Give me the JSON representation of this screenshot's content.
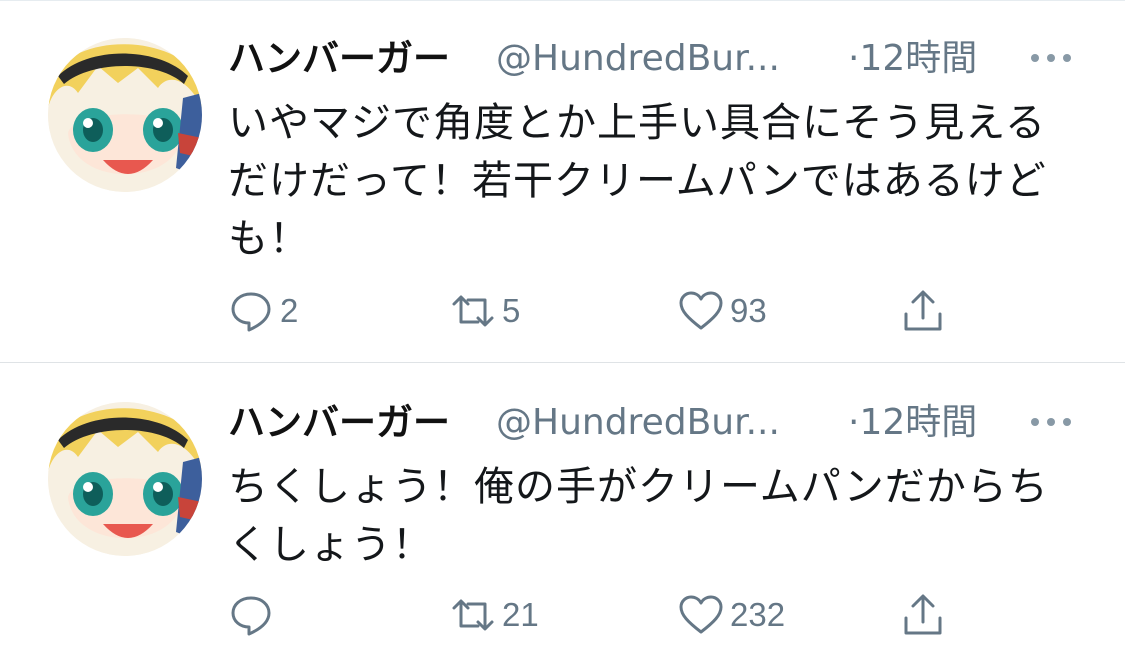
{
  "tweets": [
    {
      "name": "ハンバーガー",
      "handle": "@HundredBur...",
      "time": "·12時間",
      "lines": [
        "いやマジで角度とか上手い具合にそう見える",
        "だけだって！若干クリームパンではあるけど",
        "も！"
      ],
      "reply_count": "2",
      "retweet_count": "5",
      "like_count": "93"
    },
    {
      "name": "ハンバーガー",
      "handle": "@HundredBur...",
      "time": "·12時間",
      "lines": [
        "ちくしょう！俺の手がクリームパンだからち",
        "くしょう！"
      ],
      "reply_count": "",
      "retweet_count": "21",
      "like_count": "232"
    }
  ],
  "icons": {
    "reply": "speech-bubble-icon",
    "retweet": "retweet-icon",
    "like": "heart-icon",
    "share": "share-icon",
    "more": "more-dots-icon"
  },
  "colors": {
    "secondary_text": "#657786",
    "divider": "#dfe3e6"
  }
}
